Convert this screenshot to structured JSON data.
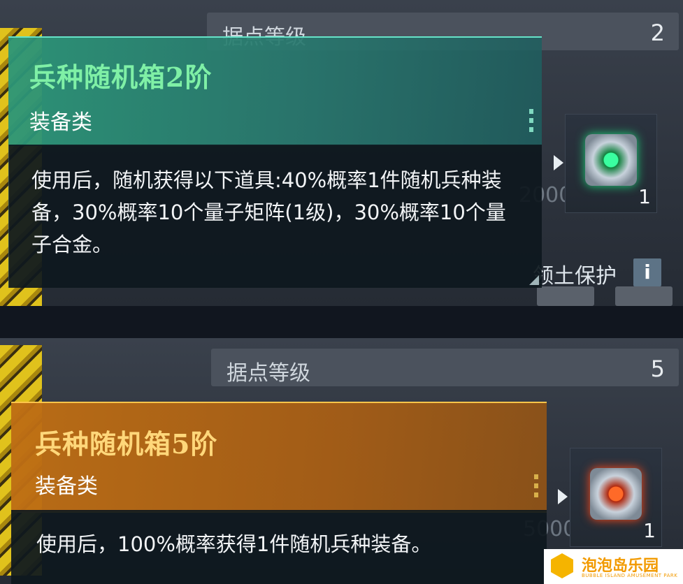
{
  "top_card": {
    "level_label": "据点等级",
    "level_value": "2",
    "item_count": "1",
    "bg_number": "2000",
    "territory_label": "领土保护",
    "info_label": "i",
    "tooltip": {
      "title": "兵种随机箱2阶",
      "category": "装备类",
      "description": "使用后，随机获得以下道具:40%概率1件随机兵种装备，30%概率10个量子矩阵(1级)，30%概率10个量子合金。"
    }
  },
  "bottom_card": {
    "level_label": "据点等级",
    "level_value": "5",
    "item_count": "1",
    "bg_number": "5000",
    "tooltip": {
      "title": "兵种随机箱5阶",
      "category": "装备类",
      "description": "使用后，100%概率获得1件随机兵种装备。"
    }
  },
  "watermark": {
    "name": "泡泡岛乐园",
    "sub": "BUBBLE ISLAND AMUSEMENT PARK"
  },
  "colors": {
    "green_accent": "#7ff0a6",
    "orange_accent": "#ffd77a"
  }
}
